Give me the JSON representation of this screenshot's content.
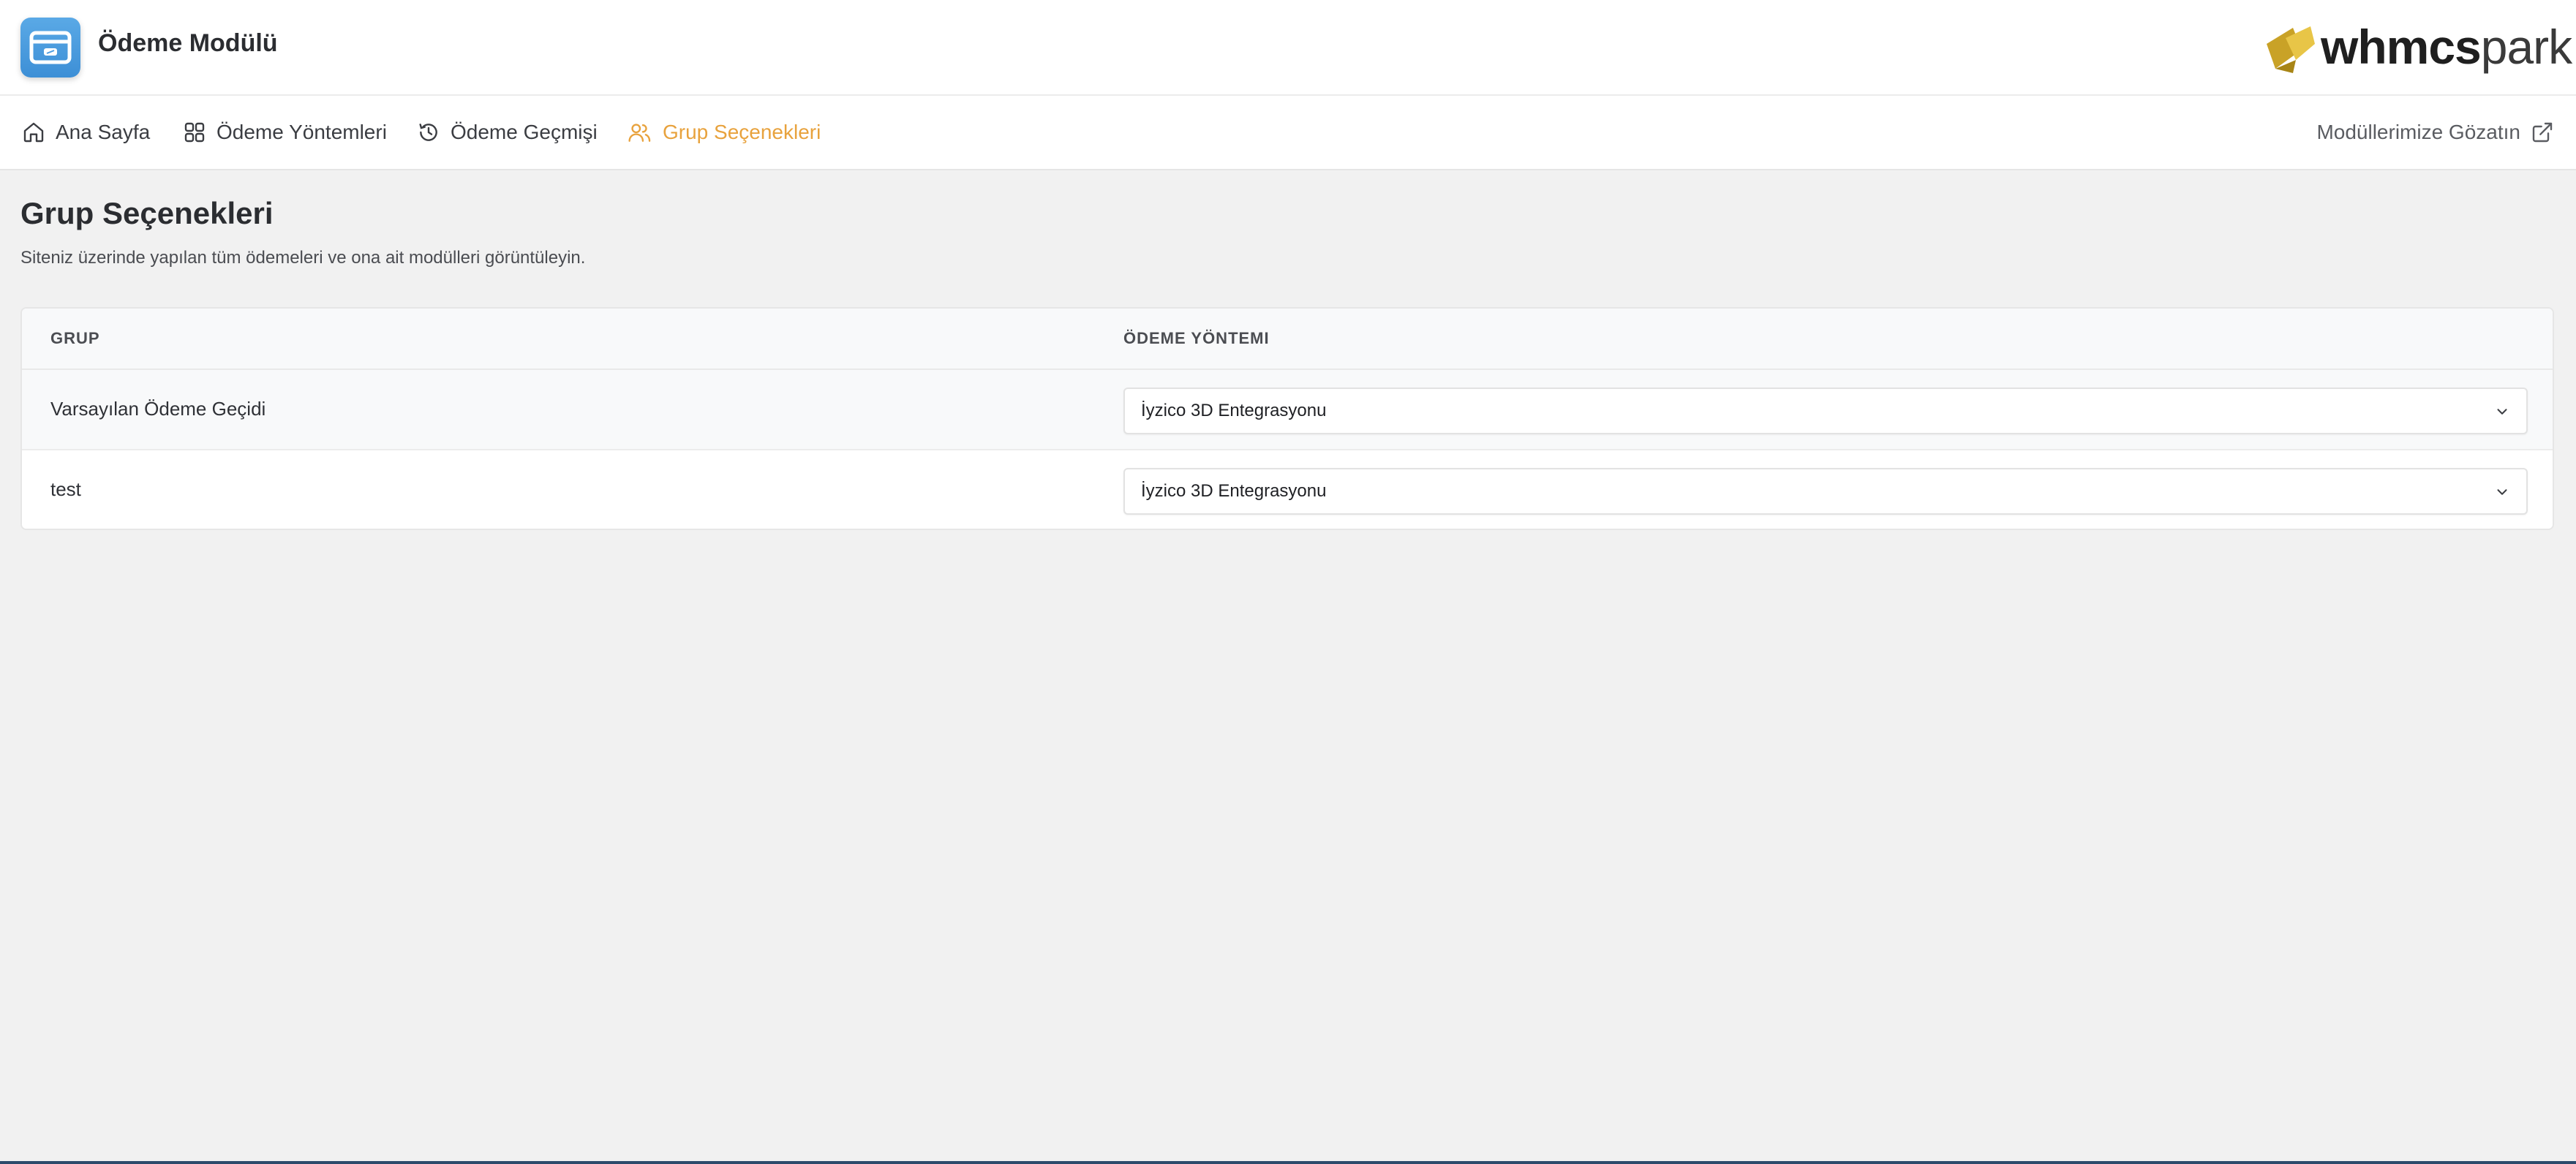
{
  "header": {
    "app_title": "Ödeme Modülü",
    "brand": {
      "part1": "whmcs",
      "part2": "park"
    }
  },
  "nav": {
    "items": [
      {
        "label": "Ana Sayfa",
        "icon": "home-icon"
      },
      {
        "label": "Ödeme Yöntemleri",
        "icon": "grid-icon"
      },
      {
        "label": "Ödeme Geçmişi",
        "icon": "history-icon"
      },
      {
        "label": "Grup Seçenekleri",
        "icon": "users-icon",
        "active": true
      }
    ],
    "external_link": {
      "label": "Modüllerimize Gözatın",
      "icon": "external-link-icon"
    }
  },
  "page": {
    "title": "Grup Seçenekleri",
    "subtitle": "Siteniz üzerinde yapılan tüm ödemeleri ve ona ait modülleri görüntüleyin."
  },
  "table": {
    "columns": [
      "GRUP",
      "ÖDEME YÖNTEMI"
    ],
    "rows": [
      {
        "group": "Varsayılan Ödeme Geçidi",
        "method": "İyzico 3D Entegrasyonu"
      },
      {
        "group": "test",
        "method": "İyzico 3D Entegrasyonu"
      }
    ]
  },
  "colors": {
    "accent": "#e8a23d",
    "app_icon": "#4a9be0",
    "background": "#f1f1f1"
  }
}
